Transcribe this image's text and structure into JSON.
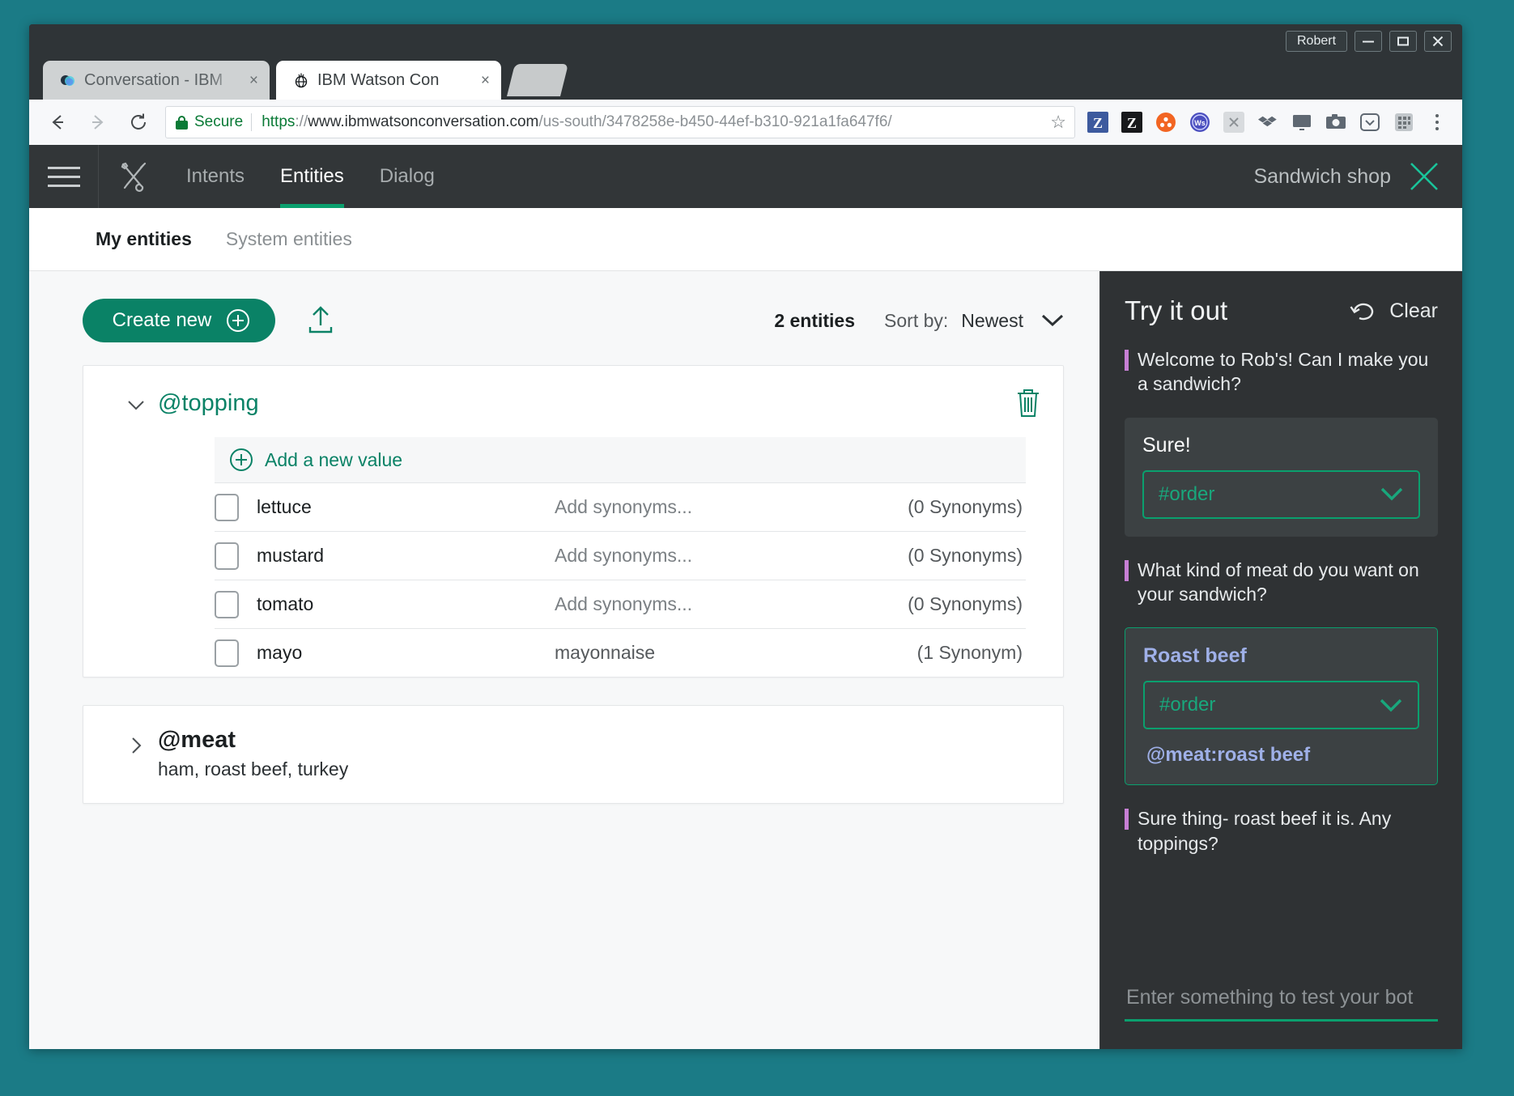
{
  "window": {
    "user_label": "Robert",
    "minimize_icon": "minimize-icon",
    "maximize_icon": "maximize-icon",
    "close_icon": "close-icon"
  },
  "browser": {
    "tabs": [
      {
        "title": "Conversation - IBM",
        "favicon": "conversation-favicon",
        "close": "×"
      },
      {
        "title": "IBM Watson Con",
        "favicon": "ibm-watson-favicon",
        "close": "×"
      }
    ],
    "back_icon": "back-arrow-icon",
    "forward_icon": "forward-arrow-icon",
    "reload_icon": "reload-icon",
    "secure_label": "Secure",
    "url_scheme": "https",
    "url_separator": "://",
    "url_host": "www.ibmwatsonconversation.com",
    "url_path": "/us-south/3478258e-b450-44ef-b310-921a1fa647f6/",
    "bookmark_icon": "star-icon",
    "extensions": [
      "zotero-blue-icon",
      "zotero-black-icon",
      "orange-circle-icon",
      "ws-globe-icon",
      "gray-tool-icon",
      "dropbox-icon",
      "cast-icon",
      "camera-icon",
      "pocket-icon",
      "grid-icon"
    ],
    "menu_icon": "three-dots-menu-icon"
  },
  "appnav": {
    "menu_icon": "hamburger-menu-icon",
    "tools_icon": "tools-icon",
    "tabs": [
      {
        "label": "Intents",
        "active": false
      },
      {
        "label": "Entities",
        "active": true
      },
      {
        "label": "Dialog",
        "active": false
      }
    ],
    "workspace": "Sandwich shop",
    "close_icon": "close-workspace-icon",
    "accent": "#0aa06e"
  },
  "subtabs": [
    {
      "label": "My entities",
      "active": true
    },
    {
      "label": "System entities",
      "active": false
    }
  ],
  "toolbar": {
    "create_new_label": "Create new",
    "create_new_icon": "plus-circle-icon",
    "upload_icon": "upload-icon",
    "entity_count": "2 entities",
    "sort_by_label": "Sort by:",
    "sort_value": "Newest",
    "sort_chevron": "chevron-down-icon",
    "button_color": "#0a8266"
  },
  "entities": [
    {
      "name": "@topping",
      "expanded": true,
      "chevron": "chevron-down-icon",
      "trash_icon": "trash-icon",
      "add_value_label": "Add a new value",
      "add_value_icon": "plus-circle-icon",
      "values": [
        {
          "name": "lettuce",
          "synonyms": "Add synonyms...",
          "synonyms_is_placeholder": true,
          "count": "(0 Synonyms)"
        },
        {
          "name": "mustard",
          "synonyms": "Add synonyms...",
          "synonyms_is_placeholder": true,
          "count": "(0 Synonyms)"
        },
        {
          "name": "tomato",
          "synonyms": "Add synonyms...",
          "synonyms_is_placeholder": true,
          "count": "(0 Synonyms)"
        },
        {
          "name": "mayo",
          "synonyms": "mayonnaise",
          "synonyms_is_placeholder": false,
          "count": "(1 Synonym)"
        }
      ]
    },
    {
      "name": "@meat",
      "expanded": false,
      "chevron": "chevron-right-icon",
      "values_summary": "ham,  roast beef,  turkey"
    }
  ],
  "try_it_out": {
    "title": "Try it out",
    "clear_label": "Clear",
    "clear_icon": "undo-icon",
    "messages": [
      {
        "type": "bot",
        "text": "Welcome to Rob's! Can I make you a sandwich?"
      },
      {
        "type": "user",
        "text": "Sure!",
        "intent": "#order",
        "intent_chevron": "chevron-down-icon",
        "outlined": false,
        "blue_text": false
      },
      {
        "type": "bot",
        "text": "What kind of meat do you want on your sandwich?"
      },
      {
        "type": "user",
        "text": "Roast beef",
        "intent": "#order",
        "intent_chevron": "chevron-down-icon",
        "entity": "@meat:roast beef",
        "outlined": true,
        "blue_text": true
      },
      {
        "type": "bot",
        "text": "Sure thing- roast beef it is. Any toppings?"
      }
    ],
    "input_placeholder": "Enter something to test your bot",
    "accent": "#0aa06e",
    "bot_marker_color": "#c77fd4"
  }
}
